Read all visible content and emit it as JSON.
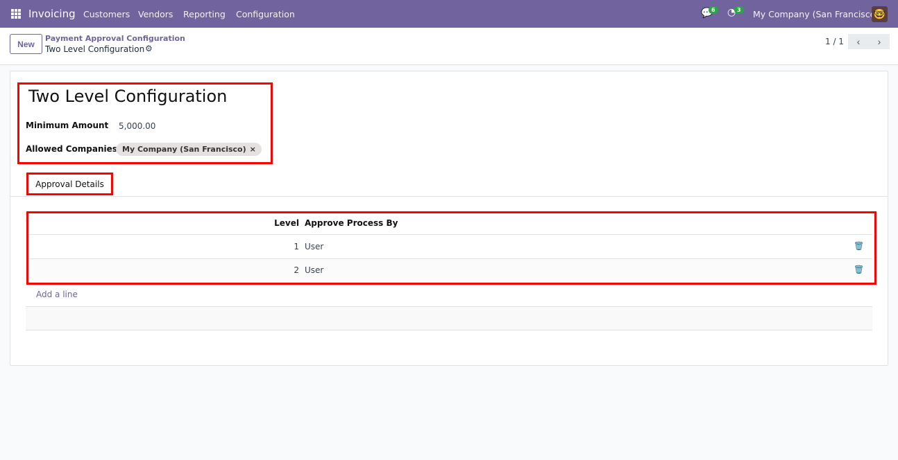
{
  "navbar": {
    "app": "Invoicing",
    "menu": [
      "Customers",
      "Vendors",
      "Reporting",
      "Configuration"
    ],
    "messages_count": "6",
    "activities_count": "3",
    "company": "My Company (San Francisco)"
  },
  "control_panel": {
    "new_label": "New",
    "breadcrumb_parent": "Payment Approval Configuration",
    "breadcrumb_current": "Two Level Configuration",
    "pager": "1 / 1"
  },
  "form": {
    "title": "Two Level Configuration",
    "min_amount_label": "Minimum Amount",
    "min_amount": "5,000.00",
    "companies_label": "Allowed Companies",
    "companies": [
      "My Company (San Francisco)"
    ],
    "tab": "Approval Details",
    "table": {
      "headers": [
        "Level",
        "Approve Process By"
      ],
      "rows": [
        {
          "level": "1",
          "by": "User"
        },
        {
          "level": "2",
          "by": "User"
        }
      ]
    },
    "add_line": "Add a line"
  },
  "colors": {
    "brand": "#71639e",
    "highlight": "#ff0000"
  }
}
